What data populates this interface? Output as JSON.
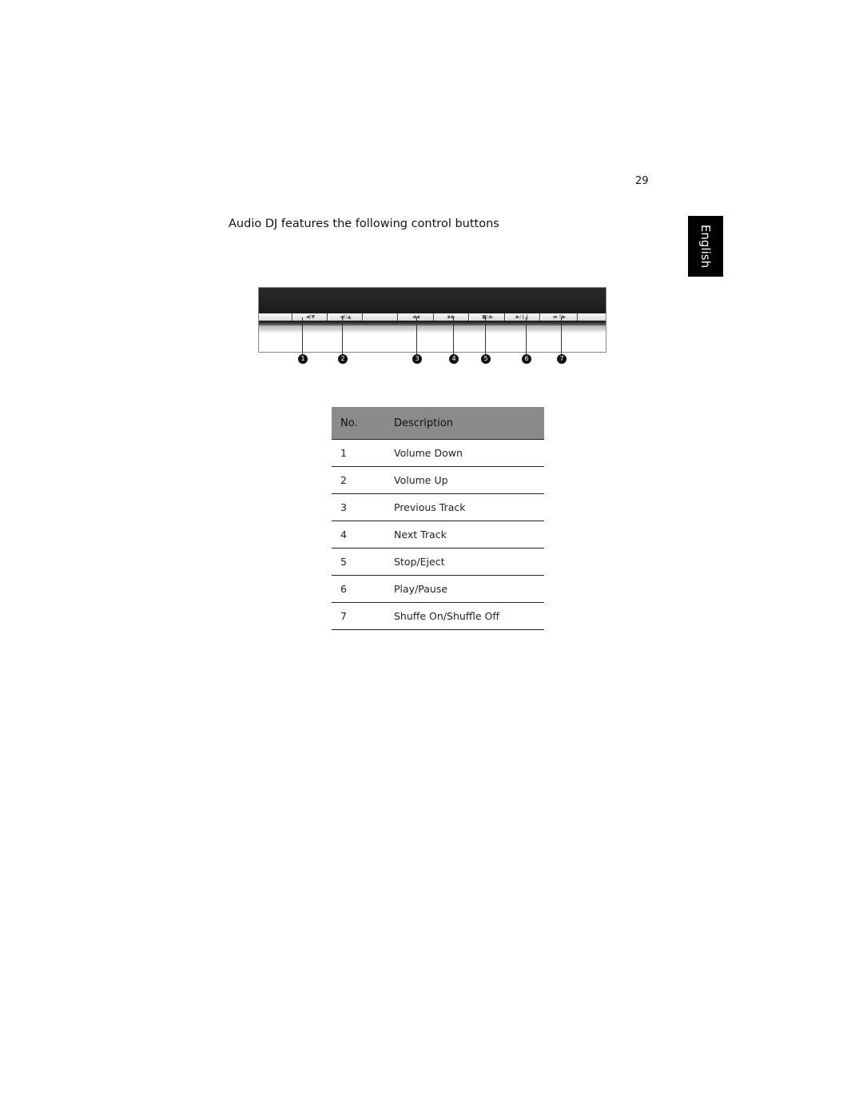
{
  "page_number": "29",
  "side_tab": "English",
  "intro": "Audio DJ features the following control buttons",
  "figure": {
    "buttons": [
      "",
      "◀)▼",
      "◀))▲",
      "",
      "◀◀",
      "▶▶",
      "■/⏏",
      "▶/❙❙",
      "▬ S▶",
      ""
    ],
    "callouts": [
      "1",
      "2",
      "3",
      "4",
      "5",
      "6",
      "7"
    ]
  },
  "table": {
    "headers": [
      "No.",
      "Description"
    ],
    "rows": [
      [
        "1",
        "Volume Down"
      ],
      [
        "2",
        "Volume Up"
      ],
      [
        "3",
        "Previous Track"
      ],
      [
        "4",
        "Next Track"
      ],
      [
        "5",
        "Stop/Eject"
      ],
      [
        "6",
        "Play/Pause"
      ],
      [
        "7",
        "Shuffe On/Shuffle Off"
      ]
    ]
  }
}
